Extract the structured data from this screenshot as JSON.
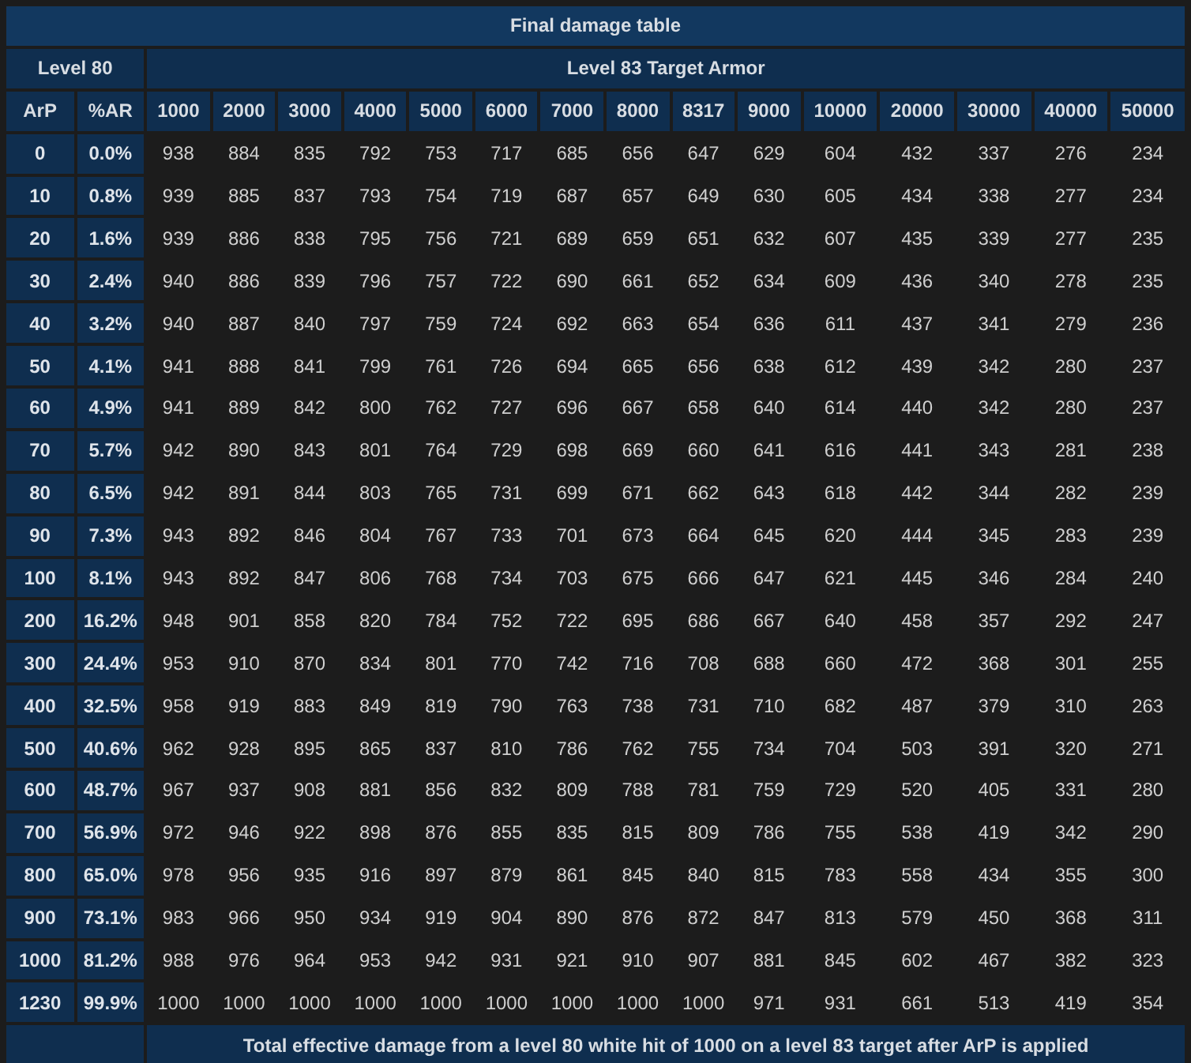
{
  "title": "Final damage table",
  "group_headers": {
    "attacker": "Level 80",
    "target": "Level 83 Target Armor"
  },
  "columns": [
    "ArP",
    "%AR",
    "1000",
    "2000",
    "3000",
    "4000",
    "5000",
    "6000",
    "7000",
    "8000",
    "8317",
    "9000",
    "10000",
    "20000",
    "30000",
    "40000",
    "50000"
  ],
  "rows": [
    {
      "arp": "0",
      "ar": "0.0%",
      "values": [
        "938",
        "884",
        "835",
        "792",
        "753",
        "717",
        "685",
        "656",
        "647",
        "629",
        "604",
        "432",
        "337",
        "276",
        "234"
      ]
    },
    {
      "arp": "10",
      "ar": "0.8%",
      "values": [
        "939",
        "885",
        "837",
        "793",
        "754",
        "719",
        "687",
        "657",
        "649",
        "630",
        "605",
        "434",
        "338",
        "277",
        "234"
      ]
    },
    {
      "arp": "20",
      "ar": "1.6%",
      "values": [
        "939",
        "886",
        "838",
        "795",
        "756",
        "721",
        "689",
        "659",
        "651",
        "632",
        "607",
        "435",
        "339",
        "277",
        "235"
      ]
    },
    {
      "arp": "30",
      "ar": "2.4%",
      "values": [
        "940",
        "886",
        "839",
        "796",
        "757",
        "722",
        "690",
        "661",
        "652",
        "634",
        "609",
        "436",
        "340",
        "278",
        "235"
      ]
    },
    {
      "arp": "40",
      "ar": "3.2%",
      "values": [
        "940",
        "887",
        "840",
        "797",
        "759",
        "724",
        "692",
        "663",
        "654",
        "636",
        "611",
        "437",
        "341",
        "279",
        "236"
      ]
    },
    {
      "arp": "50",
      "ar": "4.1%",
      "values": [
        "941",
        "888",
        "841",
        "799",
        "761",
        "726",
        "694",
        "665",
        "656",
        "638",
        "612",
        "439",
        "342",
        "280",
        "237"
      ]
    },
    {
      "arp": "60",
      "ar": "4.9%",
      "values": [
        "941",
        "889",
        "842",
        "800",
        "762",
        "727",
        "696",
        "667",
        "658",
        "640",
        "614",
        "440",
        "342",
        "280",
        "237"
      ]
    },
    {
      "arp": "70",
      "ar": "5.7%",
      "values": [
        "942",
        "890",
        "843",
        "801",
        "764",
        "729",
        "698",
        "669",
        "660",
        "641",
        "616",
        "441",
        "343",
        "281",
        "238"
      ]
    },
    {
      "arp": "80",
      "ar": "6.5%",
      "values": [
        "942",
        "891",
        "844",
        "803",
        "765",
        "731",
        "699",
        "671",
        "662",
        "643",
        "618",
        "442",
        "344",
        "282",
        "239"
      ]
    },
    {
      "arp": "90",
      "ar": "7.3%",
      "values": [
        "943",
        "892",
        "846",
        "804",
        "767",
        "733",
        "701",
        "673",
        "664",
        "645",
        "620",
        "444",
        "345",
        "283",
        "239"
      ]
    },
    {
      "arp": "100",
      "ar": "8.1%",
      "values": [
        "943",
        "892",
        "847",
        "806",
        "768",
        "734",
        "703",
        "675",
        "666",
        "647",
        "621",
        "445",
        "346",
        "284",
        "240"
      ]
    },
    {
      "arp": "200",
      "ar": "16.2%",
      "values": [
        "948",
        "901",
        "858",
        "820",
        "784",
        "752",
        "722",
        "695",
        "686",
        "667",
        "640",
        "458",
        "357",
        "292",
        "247"
      ]
    },
    {
      "arp": "300",
      "ar": "24.4%",
      "values": [
        "953",
        "910",
        "870",
        "834",
        "801",
        "770",
        "742",
        "716",
        "708",
        "688",
        "660",
        "472",
        "368",
        "301",
        "255"
      ]
    },
    {
      "arp": "400",
      "ar": "32.5%",
      "values": [
        "958",
        "919",
        "883",
        "849",
        "819",
        "790",
        "763",
        "738",
        "731",
        "710",
        "682",
        "487",
        "379",
        "310",
        "263"
      ]
    },
    {
      "arp": "500",
      "ar": "40.6%",
      "values": [
        "962",
        "928",
        "895",
        "865",
        "837",
        "810",
        "786",
        "762",
        "755",
        "734",
        "704",
        "503",
        "391",
        "320",
        "271"
      ]
    },
    {
      "arp": "600",
      "ar": "48.7%",
      "values": [
        "967",
        "937",
        "908",
        "881",
        "856",
        "832",
        "809",
        "788",
        "781",
        "759",
        "729",
        "520",
        "405",
        "331",
        "280"
      ]
    },
    {
      "arp": "700",
      "ar": "56.9%",
      "values": [
        "972",
        "946",
        "922",
        "898",
        "876",
        "855",
        "835",
        "815",
        "809",
        "786",
        "755",
        "538",
        "419",
        "342",
        "290"
      ]
    },
    {
      "arp": "800",
      "ar": "65.0%",
      "values": [
        "978",
        "956",
        "935",
        "916",
        "897",
        "879",
        "861",
        "845",
        "840",
        "815",
        "783",
        "558",
        "434",
        "355",
        "300"
      ]
    },
    {
      "arp": "900",
      "ar": "73.1%",
      "values": [
        "983",
        "966",
        "950",
        "934",
        "919",
        "904",
        "890",
        "876",
        "872",
        "847",
        "813",
        "579",
        "450",
        "368",
        "311"
      ]
    },
    {
      "arp": "1000",
      "ar": "81.2%",
      "values": [
        "988",
        "976",
        "964",
        "953",
        "942",
        "931",
        "921",
        "910",
        "907",
        "881",
        "845",
        "602",
        "467",
        "382",
        "323"
      ]
    },
    {
      "arp": "1230",
      "ar": "99.9%",
      "values": [
        "1000",
        "1000",
        "1000",
        "1000",
        "1000",
        "1000",
        "1000",
        "1000",
        "1000",
        "971",
        "931",
        "661",
        "513",
        "419",
        "354"
      ]
    }
  ],
  "caption": "Total effective damage from a level 80 white hit of 1000 on a level 83 target after ArP is applied"
}
